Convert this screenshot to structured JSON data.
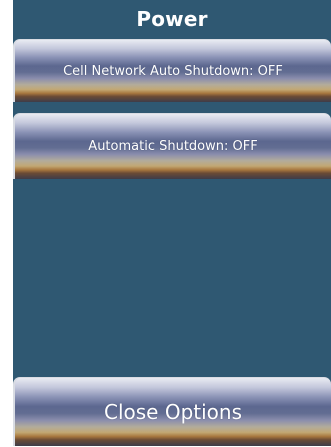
{
  "header": {
    "title": "Power"
  },
  "options": [
    {
      "label": "Cell Network Auto Shutdown: OFF"
    },
    {
      "label": "Automatic Shutdown: OFF"
    }
  ],
  "footer": {
    "close_label": "Close Options"
  },
  "colors": {
    "panel_background": "#2f5872",
    "page_background": "#ffffff",
    "text": "#ffffff"
  }
}
